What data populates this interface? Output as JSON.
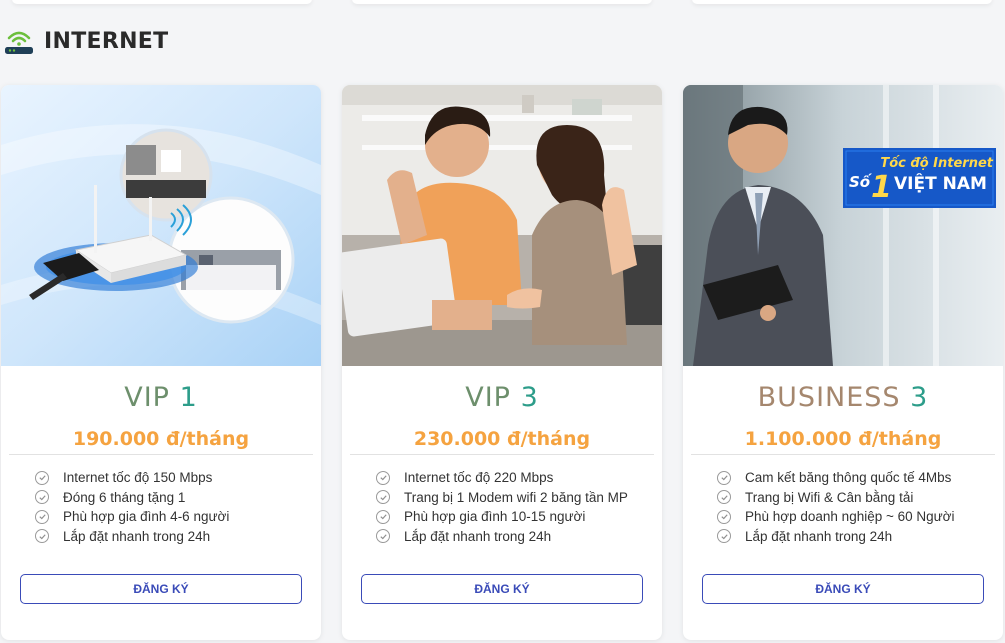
{
  "section": {
    "title": "INTERNET",
    "icon": "wifi-router-icon"
  },
  "colors": {
    "price": "#f5a340",
    "button": "#3a4bb8",
    "plan_name": "#6d8f6c",
    "plan_accent": "#2d9d8a"
  },
  "badge": {
    "line1": "Tốc độ Internet",
    "line2_prefix": "Số",
    "line2_number": "1",
    "line2": "VIỆT NAM"
  },
  "plans": [
    {
      "name_main": "VIP",
      "name_accent": "1",
      "price": "190.000 đ/tháng",
      "features": [
        "Internet tốc độ 150 Mbps",
        "Đóng 6 tháng tặng 1",
        "Phù hợp gia đình 4-6 người",
        "Lắp đặt nhanh trong 24h"
      ],
      "button": "ĐĂNG KÝ"
    },
    {
      "name_main": "VIP",
      "name_accent": "3",
      "price": "230.000 đ/tháng",
      "features": [
        "Internet tốc độ 220 Mbps",
        "Trang bị 1 Modem wifi 2 băng tần MP",
        "Phù hợp gia đình 10-15 người",
        "Lắp đặt nhanh trong 24h"
      ],
      "button": "ĐĂNG KÝ"
    },
    {
      "name_main": "BUSINESS",
      "name_accent": "3",
      "price": "1.100.000 đ/tháng",
      "features": [
        "Cam kết băng thông quốc tế 4Mbs",
        "Trang bị Wifi & Cân bằng tải",
        "Phù hợp doanh nghiệp ~ 60 Người",
        "Lắp đặt nhanh trong 24h"
      ],
      "button": "ĐĂNG KÝ"
    }
  ]
}
